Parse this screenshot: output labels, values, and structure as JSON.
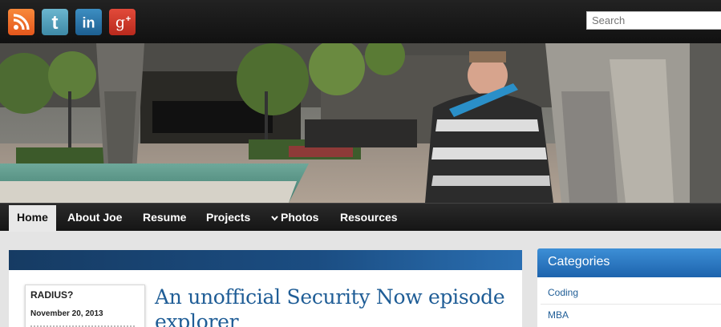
{
  "social": [
    {
      "name": "rss-icon"
    },
    {
      "name": "twitter-icon"
    },
    {
      "name": "linkedin-icon"
    },
    {
      "name": "google-plus-icon"
    }
  ],
  "search": {
    "placeholder": "Search"
  },
  "nav": {
    "items": [
      "Home",
      "About Joe",
      "Resume",
      "Projects",
      "Photos",
      "Resources"
    ],
    "active": "Home"
  },
  "post": {
    "meta_title": "RADIUS?",
    "meta_date": "November 20, 2013",
    "title": "An unofficial Security Now episode explorer"
  },
  "sidebar": {
    "heading": "Categories",
    "items": [
      "Coding",
      "MBA"
    ]
  },
  "colors": {
    "accent_blue": "#1f5d96",
    "sidebar_head": "#2b7bc8",
    "banner": "#1b4d82"
  }
}
